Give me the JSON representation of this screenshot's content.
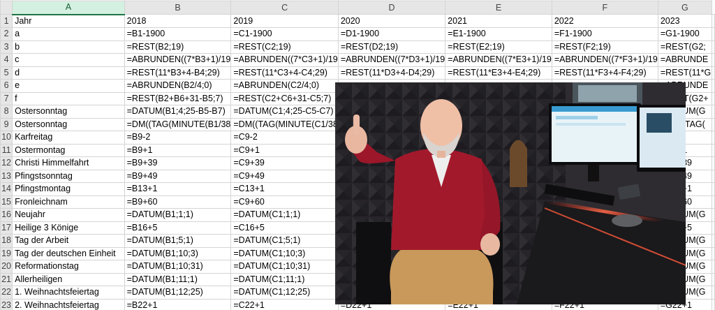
{
  "spreadsheet": {
    "partial_row_number": "23",
    "columns": [
      "A",
      "B",
      "C",
      "D",
      "E",
      "F",
      "G"
    ],
    "selected_column": "A",
    "rows": [
      {
        "num": "1",
        "cells": [
          "Jahr",
          "2018",
          "2019",
          "2020",
          "2021",
          "2022",
          "2023"
        ]
      },
      {
        "num": "2",
        "cells": [
          "a",
          "=B1-1900",
          "=C1-1900",
          "=D1-1900",
          "=E1-1900",
          "=F1-1900",
          "=G1-1900"
        ]
      },
      {
        "num": "3",
        "cells": [
          "b",
          "=REST(B2;19)",
          "=REST(C2;19)",
          "=REST(D2;19)",
          "=REST(E2;19)",
          "=REST(F2;19)",
          "=REST(G2;"
        ]
      },
      {
        "num": "4",
        "cells": [
          "c",
          "=ABRUNDEN((7*B3+1)/19",
          "=ABRUNDEN((7*C3+1)/19",
          "=ABRUNDEN((7*D3+1)/19",
          "=ABRUNDEN((7*E3+1)/19",
          "=ABRUNDEN((7*F3+1)/19",
          "=ABRUNDE"
        ]
      },
      {
        "num": "5",
        "cells": [
          "d",
          "=REST(11*B3+4-B4;29)",
          "=REST(11*C3+4-C4;29)",
          "=REST(11*D3+4-D4;29)",
          "=REST(11*E3+4-E4;29)",
          "=REST(11*F3+4-F4;29)",
          "=REST(11*G"
        ]
      },
      {
        "num": "6",
        "cells": [
          "e",
          "=ABRUNDEN(B2/4;0)",
          "=ABRUNDEN(C2/4;0)",
          "",
          "",
          "",
          "=ABRUNDE"
        ]
      },
      {
        "num": "7",
        "cells": [
          "f",
          "=REST(B2+B6+31-B5;7)",
          "=REST(C2+C6+31-C5;7)",
          "",
          "",
          "",
          "=REST(G2+"
        ]
      },
      {
        "num": "8",
        "cells": [
          "Ostersonntag",
          "=DATUM(B1;4;25-B5-B7)",
          "=DATUM(C1;4;25-C5-C7)",
          "",
          "",
          "",
          "=DATUM(G"
        ]
      },
      {
        "num": "9",
        "cells": [
          "Ostersonntag",
          "=DM((TAG(MINUTE(B1/38",
          "=DM((TAG(MINUTE(C1/38",
          "",
          "",
          "",
          "=DM((TAG("
        ]
      },
      {
        "num": "10",
        "cells": [
          "Karfreitag",
          "=B9-2",
          "=C9-2",
          "",
          "",
          "",
          "=G9-2"
        ]
      },
      {
        "num": "11",
        "cells": [
          "Ostermontag",
          "=B9+1",
          "=C9+1",
          "",
          "",
          "",
          "=G9+1"
        ]
      },
      {
        "num": "12",
        "cells": [
          "Christi Himmelfahrt",
          "=B9+39",
          "=C9+39",
          "",
          "",
          "",
          "=G9+39"
        ]
      },
      {
        "num": "13",
        "cells": [
          "Pfingstsonntag",
          "=B9+49",
          "=C9+49",
          "",
          "",
          "",
          "=G9+49"
        ]
      },
      {
        "num": "14",
        "cells": [
          "Pfingstmontag",
          "=B13+1",
          "=C13+1",
          "",
          "",
          "",
          "=G13+1"
        ]
      },
      {
        "num": "15",
        "cells": [
          "Fronleichnam",
          "=B9+60",
          "=C9+60",
          "",
          "",
          "",
          "=G9+60"
        ]
      },
      {
        "num": "16",
        "cells": [
          "Neujahr",
          "=DATUM(B1;1;1)",
          "=DATUM(C1;1;1)",
          "",
          "",
          "",
          "=DATUM(G"
        ]
      },
      {
        "num": "17",
        "cells": [
          "Heilige 3 Könige",
          "=B16+5",
          "=C16+5",
          "",
          "",
          "",
          "=G16+5"
        ]
      },
      {
        "num": "18",
        "cells": [
          "Tag der Arbeit",
          "=DATUM(B1;5;1)",
          "=DATUM(C1;5;1)",
          "",
          "",
          "",
          "=DATUM(G"
        ]
      },
      {
        "num": "19",
        "cells": [
          "Tag der deutschen Einheit",
          "=DATUM(B1;10;3)",
          "=DATUM(C1;10;3)",
          "",
          "",
          "",
          "=DATUM(G"
        ]
      },
      {
        "num": "20",
        "cells": [
          "Reformationstag",
          "=DATUM(B1;10;31)",
          "=DATUM(C1;10;31)",
          "",
          "",
          "",
          "=DATUM(G"
        ]
      },
      {
        "num": "21",
        "cells": [
          "Allerheiligen",
          "=DATUM(B1;11;1)",
          "=DATUM(C1;11;1)",
          "",
          "",
          "",
          "=DATUM(G"
        ]
      },
      {
        "num": "22",
        "cells": [
          "1. Weihnachtsfeiertag",
          "=DATUM(B1;12;25)",
          "=DATUM(C1;12;25)",
          "",
          "",
          "",
          "=DATUM(G"
        ]
      },
      {
        "num": "23",
        "cells": [
          "2. Weihnachtsfeiertag",
          "=B22+1",
          "=C22+1",
          "=D22+1",
          "=E22+1",
          "=F22+1",
          "=G22+1"
        ]
      }
    ]
  },
  "photo": {
    "subject": "man-in-red-sweater-thumbs-up",
    "colors": {
      "sweater": "#a3192c",
      "trousers": "#c79a5e",
      "wall": "#242226",
      "desk_led": "#ff5a3c",
      "monitor": "#dff0f8"
    }
  }
}
